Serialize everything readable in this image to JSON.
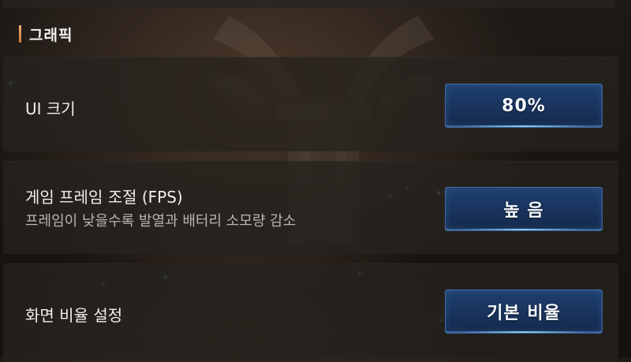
{
  "section": {
    "title": "그래픽",
    "accent_color": "#e89a58"
  },
  "settings": [
    {
      "label": "UI 크기",
      "value": "80%"
    },
    {
      "label": "게임 프레임 조절 (FPS)",
      "description": "프레임이 낮을수록 발열과 배터리 소모량 감소",
      "value": "높 음"
    },
    {
      "label": "화면 비율 설정",
      "value": "기본 비율"
    }
  ],
  "colors": {
    "button_fill": "#1a3560",
    "button_border": "#3d6aa4",
    "card_bg": "#26221f",
    "particle": "#6fc8d8"
  }
}
